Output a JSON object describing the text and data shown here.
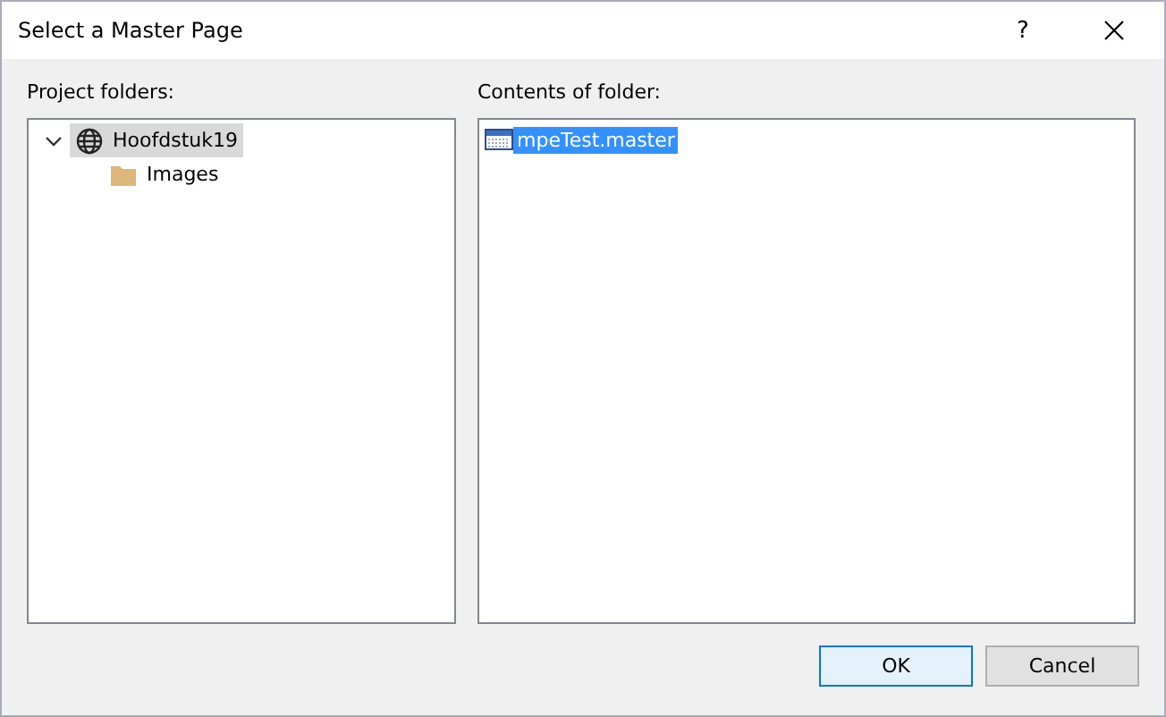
{
  "window": {
    "title": "Select a Master Page",
    "help": "?"
  },
  "project_folders": {
    "label": "Project folders:",
    "tree": [
      {
        "label": "Hoofdstuk19",
        "kind": "site",
        "expanded": true,
        "selected": true,
        "children": [
          {
            "label": "Images",
            "kind": "folder",
            "selected": false
          }
        ]
      }
    ]
  },
  "contents": {
    "label": "Contents of folder:",
    "items": [
      {
        "label": "mpeTest.master",
        "selected": true
      }
    ]
  },
  "buttons": [
    {
      "label": "OK",
      "default": true
    },
    {
      "label": "Cancel",
      "default": false
    }
  ]
}
